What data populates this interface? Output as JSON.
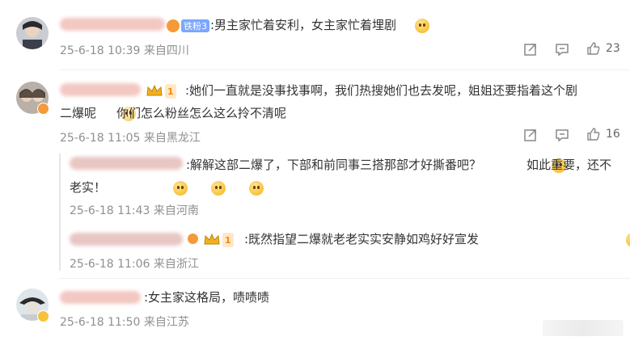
{
  "comments": [
    {
      "badge": "铁粉3",
      "text": ":男主家忙着安利，女主家忙着埋剧",
      "meta": "25-6-18 10:39 来自四川",
      "likes": "23"
    },
    {
      "level": "1",
      "text_line1": ":她们一直就是没事找事啊，我们热搜她们也去发呢，姐姐还要指着这个剧",
      "text_line2a": "二爆呢",
      "text_line2b": "你们怎么粉丝怎么这么拎不清呢",
      "meta": "25-6-18 11:05 来自黑龙江",
      "likes": "16"
    },
    {
      "badge": "",
      "text": ":女主家这格局，啧啧啧",
      "meta": "25-6-18 11:50 来自江苏"
    }
  ],
  "replies": [
    {
      "text_line1a": ":解解这部二爆了，下部和前同事三搭那部才好撕番吧？",
      "text_line1b": "如此重要，还不",
      "text_line2": "老实！",
      "meta": "25-6-18 11:43 来自河南"
    },
    {
      "level": "1",
      "text": ":既然指望二爆就老老实实安静如鸡好好宣发",
      "meta": "25-6-18 11:06 来自浙江"
    }
  ],
  "colors": {
    "meta": "#8f8f8f",
    "text": "#333333",
    "divider": "#f0f0f0",
    "gold": "#f6b40e"
  }
}
